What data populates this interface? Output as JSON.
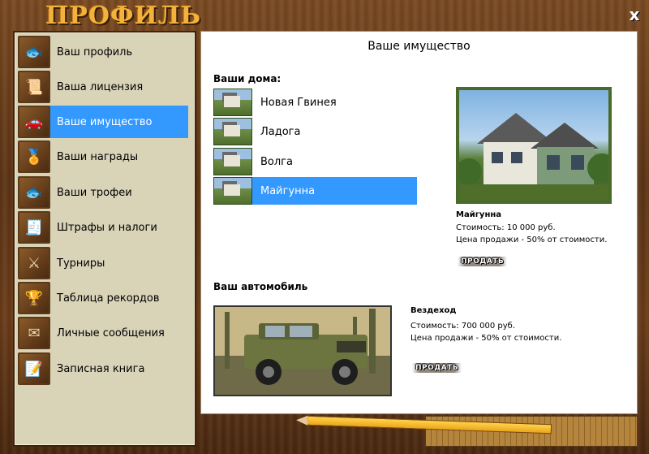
{
  "window": {
    "title": "ПРОФИЛЬ",
    "close_label": "x"
  },
  "sidebar": {
    "items": [
      {
        "label": "Ваш профиль",
        "icon": "fish-avatar-icon",
        "glyph": "🐟"
      },
      {
        "label": "Ваша лицензия",
        "icon": "license-doc-icon",
        "glyph": "📜"
      },
      {
        "label": "Ваше имущество",
        "icon": "car-house-icon",
        "glyph": "🚗",
        "active": true
      },
      {
        "label": "Ваши награды",
        "icon": "award-medal-icon",
        "glyph": "🏅"
      },
      {
        "label": "Ваши трофеи",
        "icon": "fish-trophy-icon",
        "glyph": "🐟"
      },
      {
        "label": "Штрафы и налоги",
        "icon": "fine-note-icon",
        "glyph": "🧾"
      },
      {
        "label": "Турниры",
        "icon": "crossed-swords-icon",
        "glyph": "⚔"
      },
      {
        "label": "Таблица рекордов",
        "icon": "record-badge-icon",
        "glyph": "🏆"
      },
      {
        "label": "Личные сообщения",
        "icon": "envelope-icon",
        "glyph": "✉"
      },
      {
        "label": "Записная книга",
        "icon": "notebook-pencil-icon",
        "glyph": "📝"
      }
    ]
  },
  "content": {
    "title": "Ваше имущество",
    "houses": {
      "heading": "Ваши дома:",
      "list": [
        {
          "name": "Новая Гвинея"
        },
        {
          "name": "Ладога"
        },
        {
          "name": "Волга"
        },
        {
          "name": "Майгунна",
          "active": true
        }
      ],
      "selected": {
        "name": "Майгунна",
        "cost": "Стоимость: 10 000 руб.",
        "sale": "Цена продажи - 50% от стоимости."
      },
      "sell_label": "ПРОДАТЬ"
    },
    "car": {
      "heading": "Ваш автомобиль",
      "name": "Вездеход",
      "cost": "Стоимость: 700 000 руб.",
      "sale": "Цена продажи - 50% от стоимости.",
      "sell_label": "ПРОДАТЬ"
    }
  },
  "colors": {
    "active": "#3399ff",
    "title": "#f3b23a",
    "sidebar_bg": "#d9d3b8",
    "wood": "#6b3d1a"
  }
}
